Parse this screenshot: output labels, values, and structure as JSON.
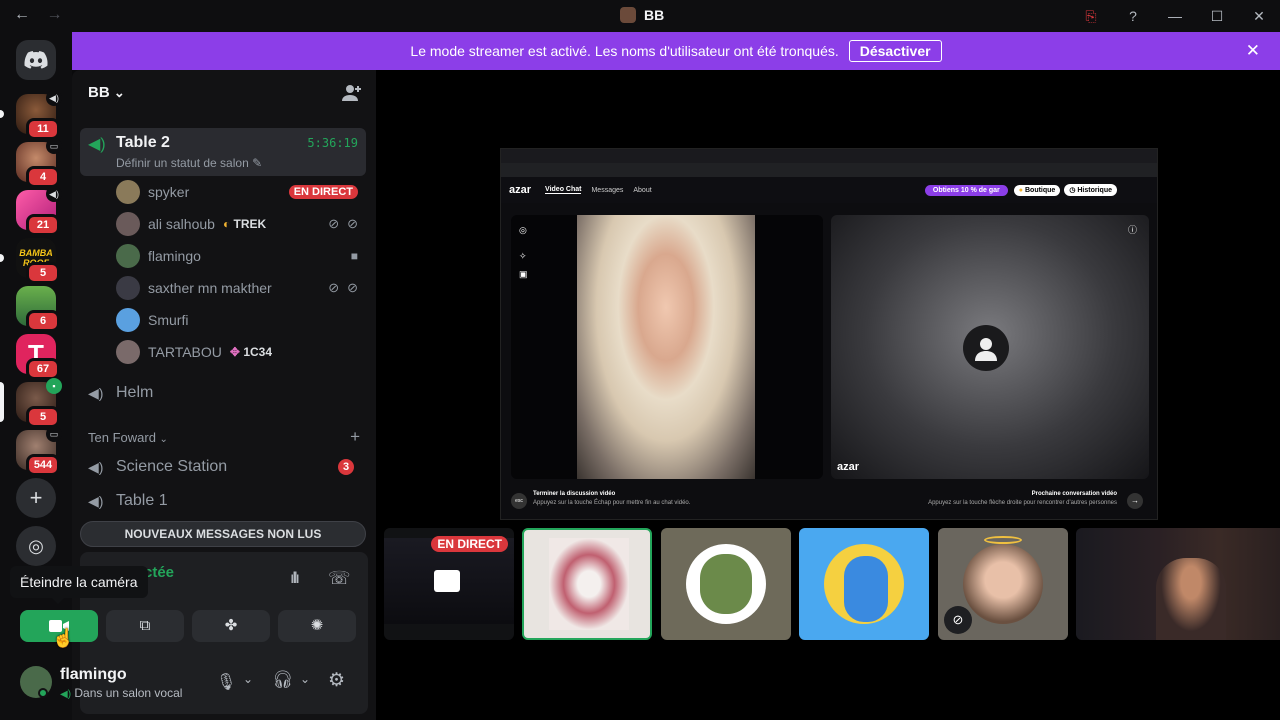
{
  "titlebar": {
    "title": "BB",
    "back": "←",
    "forward": "→",
    "controls": [
      "⎘",
      "?",
      "—",
      "☐",
      "✕"
    ]
  },
  "guilds": [
    {
      "badge": "11"
    },
    {
      "badge": "4"
    },
    {
      "badge": "21"
    },
    {
      "badge": "5"
    },
    {
      "badge": "6"
    },
    {
      "badge": "67"
    },
    {
      "badge": "5"
    },
    {
      "badge": "544"
    }
  ],
  "banner": {
    "text": "Le mode streamer est activé. Les noms d'utilisateur ont été tronqués.",
    "button": "Désactiver",
    "close": "✕"
  },
  "server": {
    "name": "BB",
    "chevron": "⌄"
  },
  "active_channel": {
    "name": "Table 2",
    "status": "Définir un statut de salon",
    "timer": "5:36:19"
  },
  "voice_users": [
    {
      "name": "spyker",
      "tag": "EN DIRECT"
    },
    {
      "name": "ali salhoub",
      "tag": "TREK"
    },
    {
      "name": "flamingo",
      "tag": ""
    },
    {
      "name": "saxther mn makther",
      "tag": ""
    },
    {
      "name": "Smurfi",
      "tag": ""
    },
    {
      "name": "TARTABOU",
      "tag": "1C34"
    }
  ],
  "channels": {
    "helm": "Helm",
    "category": "Ten Foward",
    "science": "Science Station",
    "science_badge": "3",
    "table1": "Table 1"
  },
  "new_messages": "NOUVEAUX MESSAGES NON LUS",
  "voice_panel": {
    "partial_status": "ctée",
    "tooltip": "Éteindre la caméra"
  },
  "user_panel": {
    "name": "flamingo",
    "status": "Dans un salon vocal"
  },
  "stream": {
    "brand": "azar",
    "nav": [
      "Video Chat",
      "Messages",
      "About"
    ],
    "promo": "Obtiens 10 % de gar",
    "shop": "Boutique",
    "history": "Historique",
    "end_title": "Terminer la discussion vidéo",
    "end_sub": "Appuyez sur la touche Échap pour mettre fin au chat vidéo.",
    "next_title": "Prochaine conversation vidéo",
    "next_sub": "Appuyez sur la touche flèche droite pour rencontrer d'autres personnes"
  },
  "thumbnails": {
    "live": "EN DIRECT"
  },
  "colors": {
    "accent": "#8c3ee8",
    "live": "#da373c",
    "green": "#23a55a"
  }
}
